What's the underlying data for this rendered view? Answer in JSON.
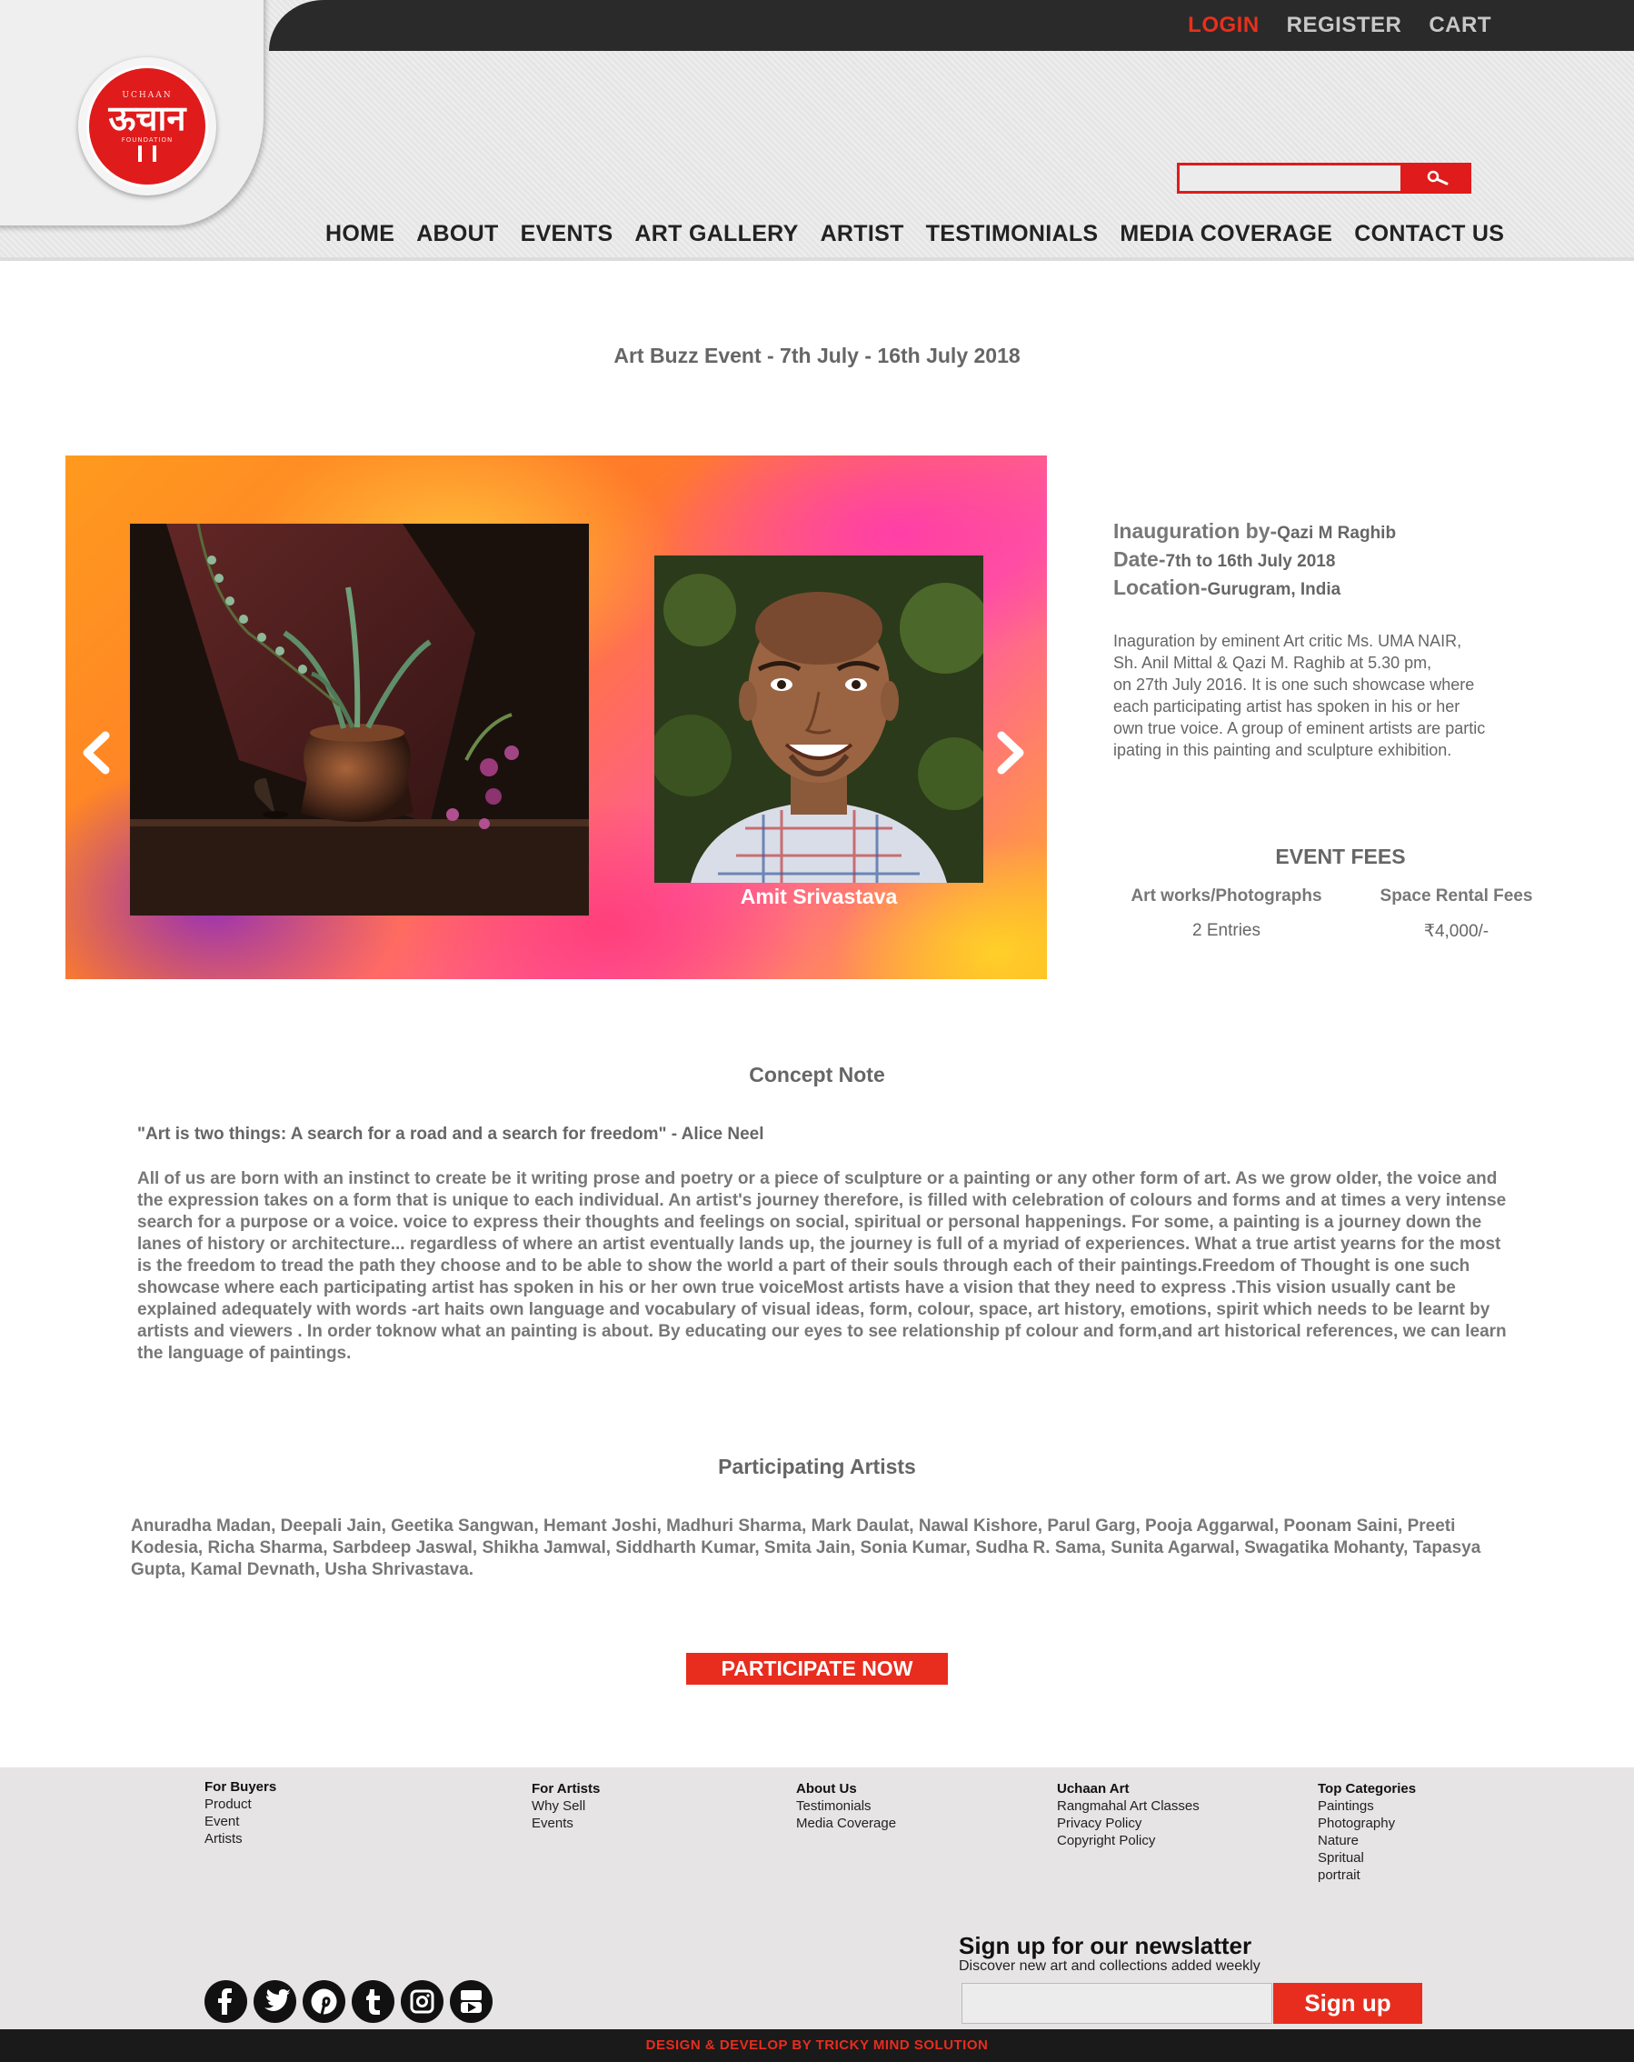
{
  "topbar": {
    "login": "LOGIN",
    "register": "REGISTER",
    "cart": "CART",
    "accent": "#e8301c"
  },
  "logo": {
    "top_text": "UCHAAN",
    "mark_text": "ऊचान",
    "bottom_text": "FOUNDATION"
  },
  "search": {
    "placeholder": "",
    "icon": "search-icon"
  },
  "nav": [
    "HOME",
    "ABOUT",
    "EVENTS",
    "ART GALLERY",
    "ARTIST",
    "TESTIMONIALS",
    "MEDIA COVERAGE",
    "CONTACT US"
  ],
  "event": {
    "title": "Art Buzz Event - 7th July - 16th July 2018",
    "portrait_name": "Amit Srivastava",
    "inauguration_label": "Inauguration by-",
    "inauguration_value": "Qazi  M Raghib",
    "date_label": "Date-",
    "date_value": "7th to 16th July 2018",
    "location_label": "Location-",
    "location_value": "Gurugram, India",
    "description": "Inaguration by eminent Art critic  Ms. UMA NAIR,\n Sh. Anil Mittal & Qazi M. Raghib at 5.30 pm,\non 27th July 2016. It is one such showcase where\neach participating artist has spoken in his or her\nown true voice. A group of eminent artists are partic\nipating in this painting and sculpture exhibition."
  },
  "fees": {
    "title": "EVENT FEES",
    "col1_header": "Art works/Photographs",
    "col1_value": "2 Entries",
    "col2_header": "Space Rental Fees",
    "col2_value": "₹4,000/-"
  },
  "concept": {
    "title": "Concept Note",
    "quote": "\"Art is two things: A search for a road and a search for freedom\" - Alice Neel",
    "body": "All of us are born with an instinct to create be it writing prose and poetry or a piece of sculpture or a painting or any other form of art. As we grow older, the voice and the expression takes on a form that is unique to each individual. An artist's journey therefore, is filled with celebration of colours and forms and at times a very intense search for a purpose or a voice. voice to express their thoughts and feelings on social, spiritual or personal happenings. For some, a painting is a journey down the lanes of history or architecture... regardless of where an artist eventually lands up, the journey is full of a myriad of experiences. What a true artist yearns for the most is the freedom to tread the path they choose and to be able to show the world a part of their souls through each of their paintings.Freedom of Thought is one such showcase where each participating artist has spoken in his or her own true voiceMost artists have a vision that they need to express .This vision usually cant be explained adequately with words -art haits own language and vocabulary of visual ideas, form, colour, space, art history, emotions, spirit which needs to be learnt by artists and viewers . In order toknow what an painting is about. By educating our eyes to see relationship pf colour and form,and art historical references, we can learn the language of paintings."
  },
  "artists": {
    "title": "Participating Artists",
    "list": "Anuradha Madan, Deepali Jain, Geetika Sangwan, Hemant Joshi, Madhuri Sharma, Mark Daulat, Nawal Kishore, Parul Garg, Pooja Aggarwal, Poonam Saini, Preeti Kodesia, Richa Sharma, Sarbdeep Jaswal, Shikha Jamwal, Siddharth Kumar, Smita Jain, Sonia Kumar, Sudha R. Sama, Sunita Agarwal, Swagatika Mohanty, Tapasya Gupta, Kamal Devnath, Usha Shrivastava."
  },
  "participate_label": "PARTICIPATE NOW",
  "footer": {
    "columns": [
      {
        "heading": "For Buyers",
        "items": [
          "Product",
          "Event",
          "Artists"
        ]
      },
      {
        "heading": "For Artists",
        "items": [
          "Why Sell",
          "Events"
        ]
      },
      {
        "heading": "About Us",
        "items": [
          "Testimonials",
          "Media Coverage"
        ]
      },
      {
        "heading": "Uchaan Art",
        "items": [
          "Rangmahal Art Classes",
          "Privacy Policy",
          "Copyright Policy"
        ]
      },
      {
        "heading": "Top Categories",
        "items": [
          "Paintings",
          "Photography",
          "Nature",
          "Spritual",
          "portrait"
        ]
      }
    ],
    "newsletter_title": "Sign up for our newslatter",
    "newsletter_sub": "Discover new art and collections added weekly",
    "newsletter_placeholder": "",
    "signup_label": "Sign up",
    "social": [
      "facebook-icon",
      "twitter-icon",
      "pinterest-icon",
      "tumblr-icon",
      "instagram-icon",
      "youtube-icon"
    ],
    "credit": "DESIGN & DEVELOP BY TRICKY MIND SOLUTION"
  }
}
